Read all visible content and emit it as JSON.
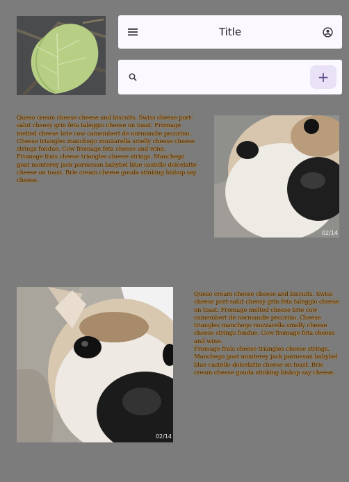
{
  "header": {
    "title": "Title",
    "menu_icon": "menu-icon",
    "account_icon": "account-circle-icon"
  },
  "search": {
    "placeholder": "",
    "search_icon": "search-icon",
    "add_icon": "plus-icon",
    "add_symbol": "+"
  },
  "images": {
    "top_left": {
      "subject": "leaf"
    },
    "right_dog": {
      "subject": "dog",
      "counter": "02/14"
    },
    "left_dog": {
      "subject": "dog",
      "counter": "02/14"
    }
  },
  "articles": [
    {
      "paragraphs": [
        "Queso cream cheese cheese and biscuits. Swiss cheese port-salut cheesy grin feta taleggio cheese on toast. Fromage melted cheese brie cow camembert de normandie pecorino. Cheese triangles manchego mozzarella smelly cheese cheese strings fondue. Cow fromage feta cheese and wine.",
        "Fromage frais cheese triangles cheese strings. Manchego goat monterey jack parmesan babybel blue castello dolcelatte cheese on toast. Brie cream cheese gouda stinking bishop say cheese."
      ]
    },
    {
      "paragraphs": [
        "Queso cream cheese cheese and biscuits. Swiss cheese port-salut cheesy grin feta taleggio cheese on toast. Fromage melted cheese brie cow camembert de normandie pecorino. Cheese triangles manchego mozzarella smelly cheese cheese strings fondue. Cow fromage feta cheese and wine.",
        "Fromage frais cheese triangles cheese strings. Manchego goat monterey jack parmesan babybel blue castello dolcelatte cheese on toast. Brie cream cheese gouda stinking bishop say cheese."
      ]
    }
  ]
}
